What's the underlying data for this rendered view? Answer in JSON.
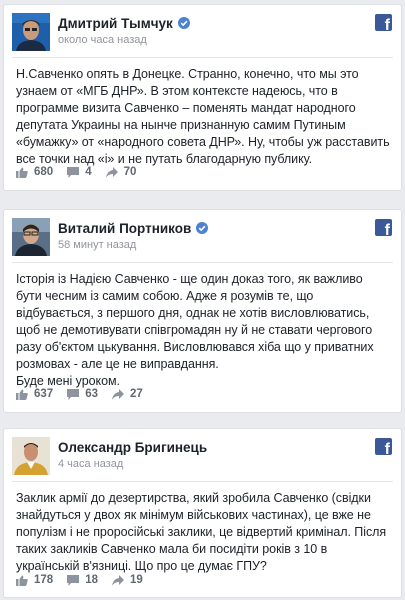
{
  "posts": [
    {
      "author": "Дмитрий Тымчук",
      "time": "около часа назад",
      "paragraphs": [
        "Н.Савченко опять в Донецке. Странно, конечно, что мы это узнаем от «МГБ ДНР». В этом контексте надеюсь, что в программе визита Савченко – поменять мандат народного депутата Украины на нынче признанную самим Путиным «бумажку» от «народного совета ДНР». Ну, чтобы уж расставить все точки над «і» и не путать благодарную публику."
      ],
      "likes": "680",
      "comments": "4",
      "shares": "70"
    },
    {
      "author": "Виталий Портников",
      "time": "58 минут назад",
      "paragraphs": [
        "Історія із Надією Савченко - ще один доказ того, як важливо бути чесним із самим собою. Адже я розумів те, що відбувається, з першого дня, однак не хотів висловлюватись, щоб не демотивувати співгромадян ну й не ставати чергового разу об'єктом цькування. Висловлювався хіба що у приватних розмовах - але це не виправдання.",
        "Буде мені уроком."
      ],
      "likes": "637",
      "comments": "63",
      "shares": "27"
    },
    {
      "author": "Олександр Бригинець",
      "time": "4 часа назад",
      "paragraphs": [
        "Заклик армії до дезертирства, який зробила Савченко (свідки знайдуться у двох як мінімум військових частинах), це вже не популізм і не проросійські заклики, це відвертий кримінал. Після таких закликів Савченко мала би посидіти років з 10 в українській в'язниці. Що про це думає ГПУ?"
      ],
      "likes": "178",
      "comments": "18",
      "shares": "19"
    }
  ],
  "colors": {
    "facebook_blue": "#3b5998",
    "verified_badge": "#4b83d1",
    "meta_gray": "#90949c",
    "page_bg": "#e9ebee"
  },
  "icons": {
    "source": "facebook-icon",
    "like": "thumbs-up-icon",
    "comment": "comment-icon",
    "share": "share-arrow-icon",
    "verified": "verified-check-icon"
  }
}
